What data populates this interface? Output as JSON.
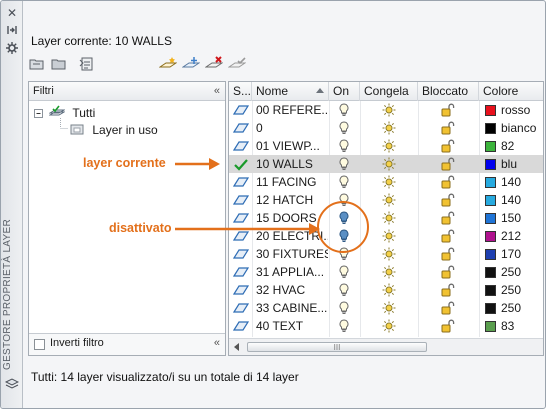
{
  "palette": {
    "vertical_title": "GESTORE PROPRIETÀ LAYER",
    "current_layer_label": "Layer corrente: 10 WALLS",
    "status_text": "Tutti: 14 layer visualizzato/i su un totale di 14 layer"
  },
  "filters": {
    "header": "Filtri",
    "tree": [
      {
        "label": "Tutti"
      },
      {
        "label": "Layer in uso"
      }
    ],
    "invert_label": "Inverti filtro",
    "invert_checked": false
  },
  "grid": {
    "columns": [
      "S...",
      "Nome",
      "On",
      "Congela",
      "Bloccato",
      "Colore"
    ],
    "rows": [
      {
        "name": "00 REFERE...",
        "color_name": "rosso",
        "color_hex": "#e8101c",
        "status": "layer",
        "on": true,
        "current": false
      },
      {
        "name": "0",
        "color_name": "bianco",
        "color_hex": "#000000",
        "status": "layer",
        "on": true,
        "current": false
      },
      {
        "name": "01 VIEWP...",
        "color_name": "82",
        "color_hex": "#3cb43c",
        "status": "layer",
        "on": true,
        "current": false
      },
      {
        "name": "10 WALLS",
        "color_name": "blu",
        "color_hex": "#0000ee",
        "status": "current",
        "on": true,
        "current": true
      },
      {
        "name": "11 FACING",
        "color_name": "140",
        "color_hex": "#27aadf",
        "status": "layer",
        "on": true,
        "current": false
      },
      {
        "name": "12 HATCH",
        "color_name": "140",
        "color_hex": "#27aadf",
        "status": "layer",
        "on": true,
        "current": false
      },
      {
        "name": "15 DOORS",
        "color_name": "150",
        "color_hex": "#1f74d6",
        "status": "layer",
        "on": false,
        "current": false
      },
      {
        "name": "20 ELECTRI...",
        "color_name": "212",
        "color_hex": "#b0128f",
        "status": "layer",
        "on": false,
        "current": false
      },
      {
        "name": "30 FIXTURES",
        "color_name": "170",
        "color_hex": "#1e3fb0",
        "status": "layer",
        "on": true,
        "current": false
      },
      {
        "name": "31 APPLIA...",
        "color_name": "250",
        "color_hex": "#111111",
        "status": "layer",
        "on": true,
        "current": false
      },
      {
        "name": "32 HVAC",
        "color_name": "250",
        "color_hex": "#111111",
        "status": "layer",
        "on": true,
        "current": false
      },
      {
        "name": "33 CABINE...",
        "color_name": "250",
        "color_hex": "#111111",
        "status": "layer",
        "on": true,
        "current": false
      },
      {
        "name": "40 TEXT",
        "color_name": "83",
        "color_hex": "#5a9e4e",
        "status": "layer",
        "on": true,
        "current": false
      }
    ],
    "scroll_grip": "III"
  },
  "annotations": {
    "current_layer": "layer corrente",
    "off": "disattivato",
    "accent": "#e3701b"
  },
  "icons": {
    "close": "close-icon",
    "autohide": "autohide-pin-icon",
    "settings": "properties-icon"
  }
}
